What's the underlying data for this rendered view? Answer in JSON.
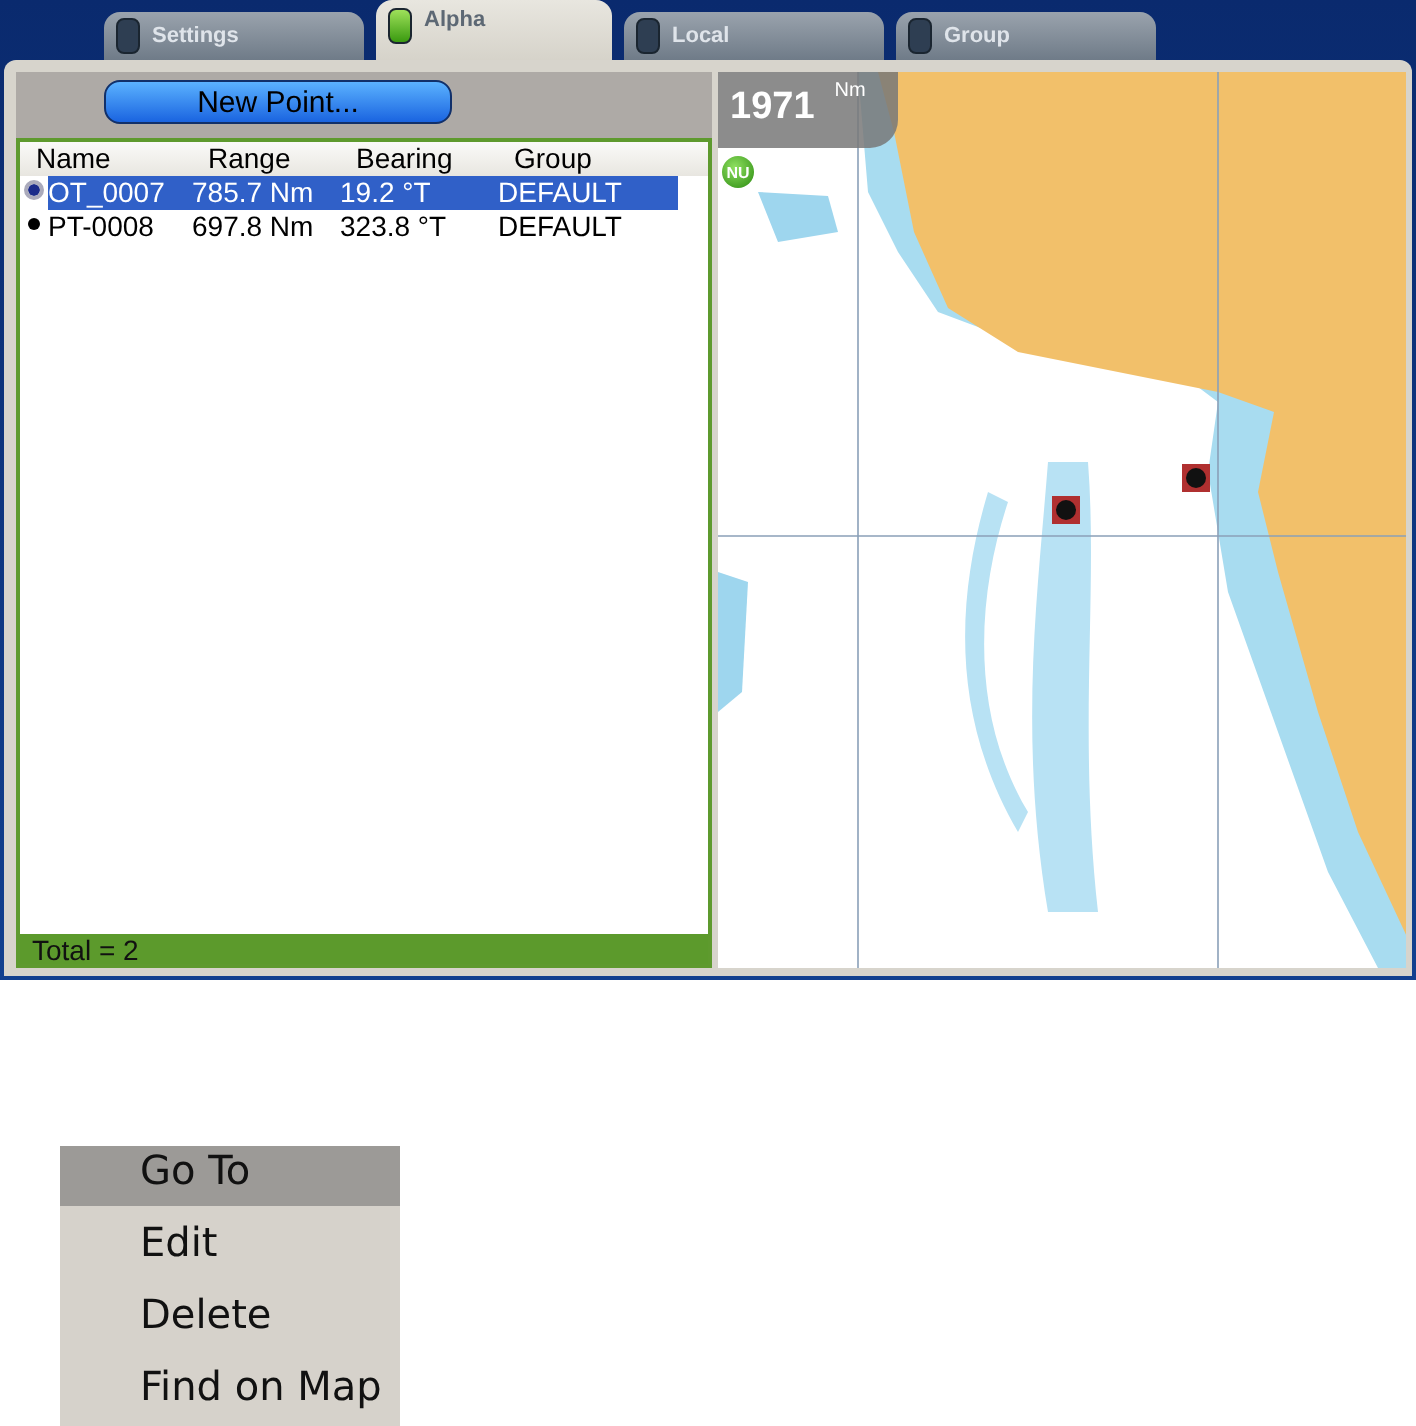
{
  "tabs": [
    {
      "label": "Settings",
      "selected": false
    },
    {
      "label": "Alpha",
      "selected": true
    },
    {
      "label": "Local",
      "selected": false
    },
    {
      "label": "Group",
      "selected": false
    }
  ],
  "new_point_button": "New Point...",
  "table": {
    "columns": [
      "Name",
      "Range",
      "Bearing",
      "Group"
    ],
    "rows": [
      {
        "cells": [
          "OT_0007",
          "785.7 Nm",
          "19.2 °T",
          "DEFAULT"
        ],
        "selected": true
      },
      {
        "cells": [
          "PT-0008",
          "697.8 Nm",
          "323.8 °T",
          "DEFAULT"
        ],
        "selected": false
      }
    ]
  },
  "status_bar": "Total = 2",
  "map": {
    "kind": "picture",
    "scale": {
      "value": "1971",
      "unit": "Nm"
    },
    "badge": "NU"
  },
  "context_menu": [
    {
      "label": "Go To",
      "selected": true
    },
    {
      "label": "Edit",
      "selected": false
    },
    {
      "label": "Delete",
      "selected": false
    },
    {
      "label": "Find on Map",
      "selected": false
    }
  ]
}
